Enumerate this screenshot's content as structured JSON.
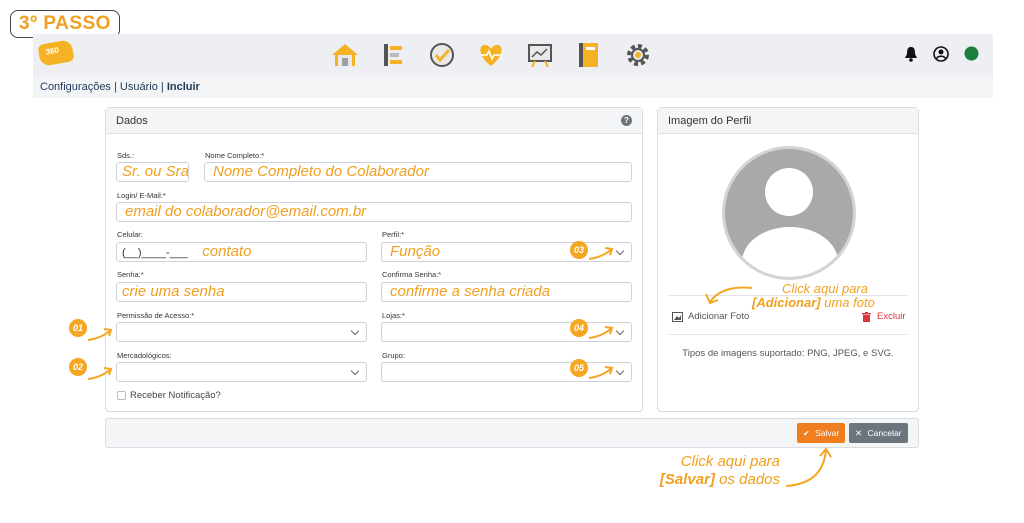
{
  "step_badge": "3º PASSO",
  "logo_text": "360",
  "nav_icons": [
    "home-icon",
    "list-icon",
    "check-circle-icon",
    "heart-pulse-icon",
    "chart-board-icon",
    "notebook-icon",
    "settings-gear-icon"
  ],
  "right_icons": [
    "bell-icon",
    "user-circle-icon",
    "status-dot-icon"
  ],
  "colors": {
    "accent": "#f0a020",
    "status_online": "#1a7f3c",
    "save_button": "#f07d1e",
    "cancel_button": "#6c757d",
    "excluir_red": "#d9363e"
  },
  "breadcrumb": {
    "part1": "Configurações",
    "sep1": " | ",
    "part2": "Usuário",
    "sep2": " | ",
    "current": "Incluir"
  },
  "dados": {
    "title": "Dados",
    "help": "?",
    "sds_label": "Sds.:",
    "sds_value": "Sr. ou Sra.",
    "nome_label": "Nome Completo:*",
    "nome_value": "Nome Completo do Colaborador",
    "login_label": "Login/ E-Mail:*",
    "login_value": "email do colaborador@email.com.br",
    "celular_label": "Celular:",
    "celular_mask": "(__)____-___",
    "celular_value": "contato",
    "perfil_label": "Perfil:*",
    "perfil_value": "Função",
    "senha_label": "Senha:*",
    "senha_value": "crie uma senha",
    "confirma_label": "Confirma Senha:*",
    "confirma_value": "confirme a senha criada",
    "permissao_label": "Permissão de Acesso:*",
    "lojas_label": "Lojas:*",
    "mercado_label": "Mercadológicos:",
    "grupo_label": "Grupo:",
    "receber_label": "Receber Notificação?"
  },
  "markers": {
    "m1": "01",
    "m2": "02",
    "m3": "03",
    "m4": "04",
    "m5": "05"
  },
  "perfil_card": {
    "title": "Imagem do Perfil",
    "add_photo": "Adicionar Foto",
    "excluir": "Excluir",
    "types": "Tipos de imagens suportado: PNG, JPEG, e SVG."
  },
  "hint_photo": {
    "line1": "Click aqui para",
    "line2_bold": "[Adicionar]",
    "line2_rest": " uma foto"
  },
  "footer": {
    "save": "Salvar",
    "cancel": "Cancelar"
  },
  "hint_save": {
    "line1": "Click aqui para",
    "line2_bold": "[Salvar]",
    "line2_rest": " os dados"
  }
}
